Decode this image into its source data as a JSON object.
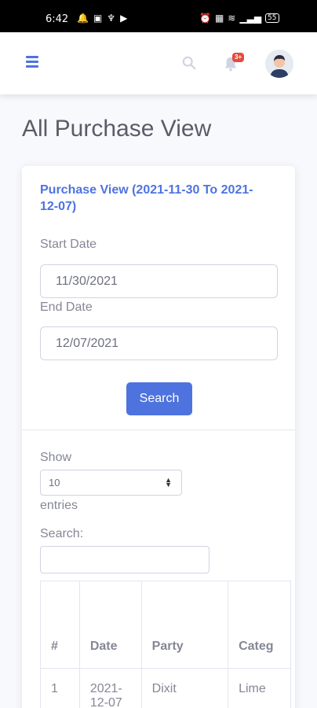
{
  "status_bar": {
    "time": "6:42",
    "battery": "55"
  },
  "topbar": {
    "alerts_badge": "3+"
  },
  "page": {
    "title": "All Purchase View"
  },
  "card": {
    "title": "Purchase View (2021-11-30 To 2021-12-07)",
    "start_date_label": "Start Date",
    "start_date_value": "11/30/2021",
    "end_date_label": "End Date",
    "end_date_value": "12/07/2021",
    "search_button": "Search"
  },
  "table_controls": {
    "show_label": "Show",
    "entries_value": "10",
    "entries_label": "entries",
    "search_label": "Search:",
    "search_value": ""
  },
  "table": {
    "headers": [
      "#",
      "Date",
      "Party",
      "Categ"
    ],
    "rows": [
      [
        "1",
        "2021-12-07",
        "Dixit",
        "Lime"
      ]
    ]
  },
  "colors": {
    "primary": "#4e73df",
    "badge": "#e74a3b",
    "text": "#5a5c69"
  }
}
